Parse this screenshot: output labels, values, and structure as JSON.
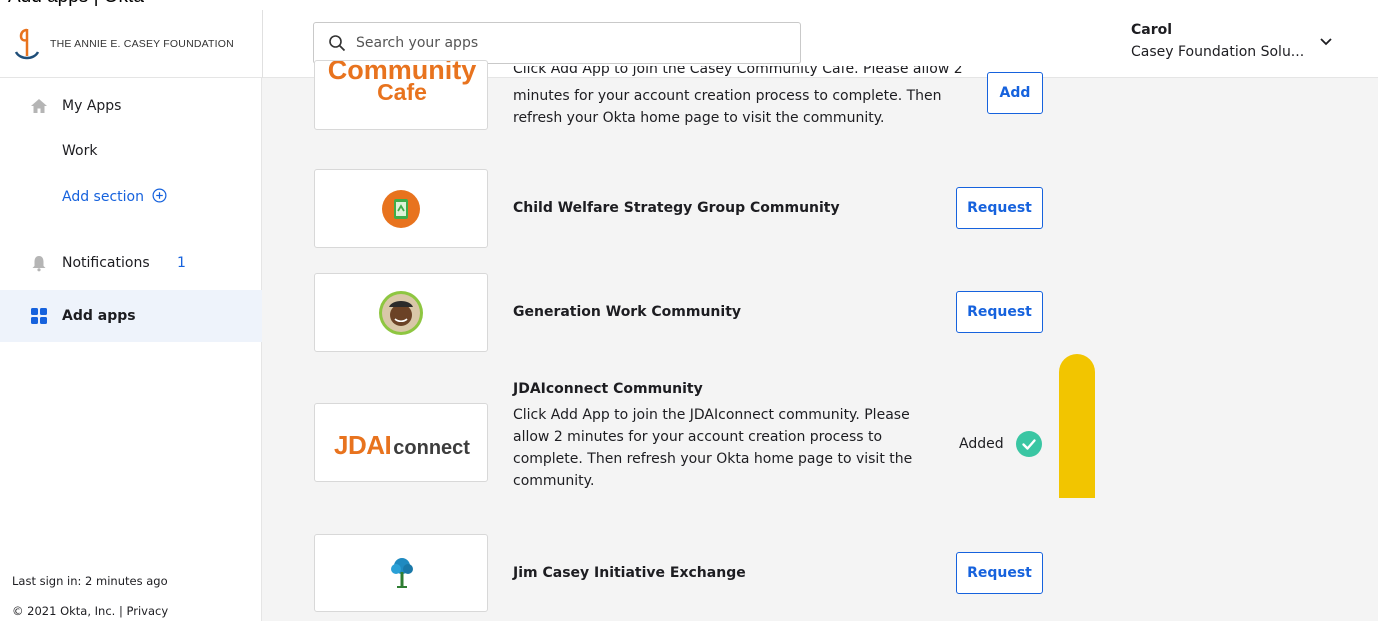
{
  "window": {
    "title": "Add apps | Okta"
  },
  "header": {
    "logo_text": "THE ANNIE E. CASEY FOUNDATION",
    "search": {
      "placeholder": "Search your apps",
      "icon": "search-icon"
    },
    "user": {
      "name": "Carol",
      "org": "Casey Foundation Solu...",
      "icon": "chevron-down-icon"
    }
  },
  "sidebar": {
    "items": [
      {
        "label": "My Apps",
        "icon": "home-icon"
      },
      {
        "label": "Work"
      },
      {
        "label": "Add section",
        "icon": "plus-circle-icon"
      },
      {
        "label": "Notifications",
        "icon": "bell-icon",
        "badge": "1"
      },
      {
        "label": "Add apps",
        "icon": "grid-icon",
        "active": true
      }
    ],
    "footer": {
      "last_sign_in": "Last sign in: 2 minutes ago",
      "copyright": "© 2021 Okta, Inc. | Privacy"
    }
  },
  "apps": [
    {
      "logo_text_1": "Community",
      "logo_text_2": "Cafe",
      "description_lines": [
        "Click Add App to join the Casey Community Cafe. Please allow 2",
        "minutes for your account creation process to complete. Then",
        "refresh your Okta home page to visit the community."
      ],
      "action": "Add"
    },
    {
      "name": "Child Welfare Strategy Group Community",
      "action": "Request"
    },
    {
      "name": "Generation Work Community",
      "action": "Request"
    },
    {
      "name": "JDAIconnect Community",
      "logo_text_1": "JDAI",
      "logo_text_2": "connect",
      "description_lines": [
        "Click Add App to join the JDAIconnect community. Please",
        "allow 2 minutes for your account creation process to",
        "complete. Then refresh your Okta home page to visit the",
        "community."
      ],
      "status": "Added"
    },
    {
      "name": "Jim Casey Initiative Exchange",
      "action": "Request"
    }
  ],
  "colors": {
    "accent": "#1662dd",
    "success": "#3ac6a3",
    "highlight": "#f2c500",
    "logo_orange": "#e8731e"
  }
}
